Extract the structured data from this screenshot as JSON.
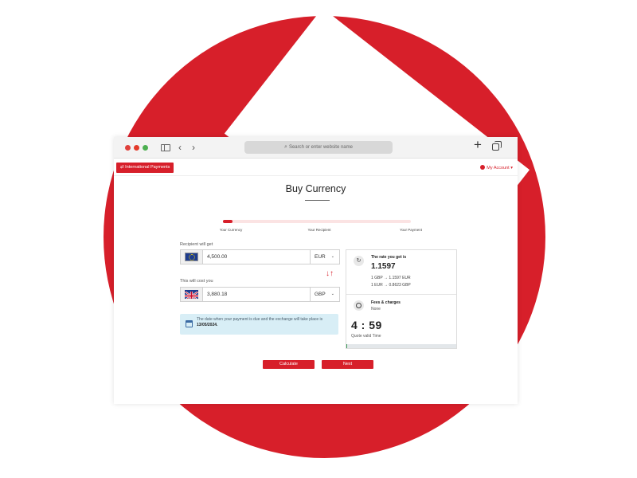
{
  "browser": {
    "url_placeholder": "Search or enter website name",
    "back_glyph": "‹",
    "forward_glyph": "›",
    "new_tab_glyph": "+"
  },
  "app": {
    "intl_payments_label": "International Payments",
    "account_label": "My Account",
    "page_title": "Buy Currency"
  },
  "stepper": {
    "progress": 0.05,
    "steps": [
      "Your Currency",
      "Your Recipient",
      "Your Payment"
    ]
  },
  "form": {
    "recipient_label": "Recipient will get",
    "recipient_amount": "4,500.00",
    "recipient_currency": "EUR",
    "cost_label": "This will cost you",
    "cost_amount": "3,880.18",
    "cost_currency": "GBP",
    "swap_glyph": "↓↑",
    "notice_text": "The date when your payment is due and the exchange will take place is",
    "notice_date": "13/05/2024."
  },
  "rate": {
    "heading": "The rate you get is",
    "value": "1.1597",
    "line1": "1 GBP → 1.1597 EUR",
    "line2": "1 EUR → 0.8623 GBP",
    "fees_heading": "Fees & charges",
    "fees_value": "None",
    "timer": "4 : 59",
    "quote_label": "Quote valid Time",
    "timer_progress": 0.01
  },
  "buttons": {
    "calculate": "Calculate",
    "next": "Next"
  },
  "colors": {
    "brand_red": "#d71f2a",
    "notice_bg": "#d8eef6",
    "timer_green": "#3f9c5a"
  },
  "icons": [
    "sidebar-icon",
    "chevron-left-icon",
    "chevron-right-icon",
    "search-icon",
    "plus-icon",
    "tabs-icon",
    "transfer-icon",
    "user-icon",
    "eu-flag-icon",
    "uk-flag-icon",
    "swap-icon",
    "calendar-icon",
    "refresh-icon",
    "clock-icon"
  ]
}
